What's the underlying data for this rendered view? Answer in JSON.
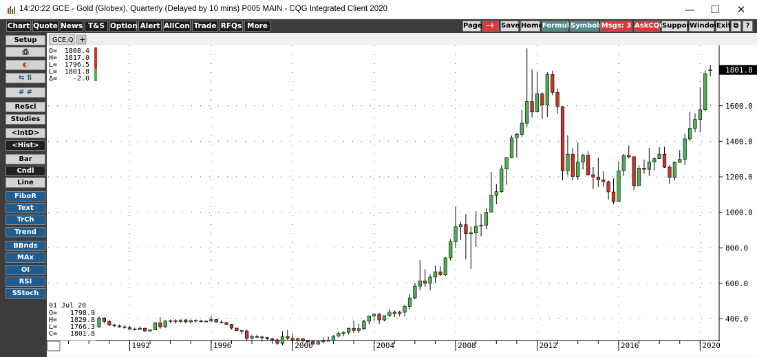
{
  "window": {
    "title": "14:20:22  GCE - Gold (Globex), Quarterly (Delayed by 10 mins)  P005 MAIN - CQG Integrated Client 2020",
    "minimize": "—",
    "maximize": "☐",
    "close": "✕"
  },
  "menu": {
    "left": [
      "Chart",
      "Quote",
      "News",
      "T&S",
      "Options",
      "Alert",
      "AllCon",
      "Trade",
      "RFQs",
      "More"
    ],
    "right": [
      {
        "label": "Page",
        "style": "gray"
      },
      {
        "label": "-+",
        "style": "red"
      },
      {
        "label": "Save",
        "style": "gray"
      },
      {
        "label": "Home",
        "style": "gray"
      },
      {
        "label": "Formula",
        "style": "teal"
      },
      {
        "label": "Symbols",
        "style": "teal"
      },
      {
        "label": "Msgs: 3",
        "style": "red"
      },
      {
        "label": "AskCQG",
        "style": "red"
      },
      {
        "label": "Support",
        "style": "gray"
      },
      {
        "label": "Window",
        "style": "gray"
      },
      {
        "label": "Exit",
        "style": "gray"
      },
      {
        "label": "⧉",
        "style": "gray"
      },
      {
        "label": "?",
        "style": "gray"
      }
    ]
  },
  "sidebar": {
    "items": [
      {
        "label": "Setup",
        "style": "gray"
      },
      {
        "label": "printer-icon",
        "style": "gray",
        "icon": true
      },
      {
        "label": "color-icon",
        "style": "gray",
        "icon": true
      },
      {
        "label": "arrows-icon",
        "style": "gray",
        "icon": true
      },
      {
        "label": "grid-icon",
        "style": "gray",
        "icon": true
      },
      {
        "label": "ReScl",
        "style": "gray"
      },
      {
        "label": "Studies",
        "style": "gray"
      },
      {
        "label": "<IntD>",
        "style": "gray"
      },
      {
        "label": "<Hist>",
        "style": "dark"
      },
      {
        "label": "Bar",
        "style": "gray"
      },
      {
        "label": "Cndl",
        "style": "dark"
      },
      {
        "label": "Line",
        "style": "gray"
      },
      {
        "label": "FiboR",
        "style": "blue"
      },
      {
        "label": "Text",
        "style": "blue"
      },
      {
        "label": "TrCh",
        "style": "blue"
      },
      {
        "label": "Trend",
        "style": "blue"
      },
      {
        "label": "BBnds",
        "style": "blue"
      },
      {
        "label": "MAx",
        "style": "blue"
      },
      {
        "label": "OI",
        "style": "blue"
      },
      {
        "label": "RSI",
        "style": "blue"
      },
      {
        "label": "SStoch",
        "style": "blue"
      }
    ]
  },
  "chart_tab": {
    "label": "GCE,Q",
    "add": "+"
  },
  "ohlc_top": {
    "O": "1808.4",
    "H": "1817.0",
    "L": "1796.5",
    "Lt": "1801.8",
    "Delta": "-2.0"
  },
  "ohlc_bottom": {
    "date": "01 Jul 20",
    "O": "1798.9",
    "H": "1829.8",
    "L": "1766.3",
    "C": "1801.8"
  },
  "last_price_label": "1801.8",
  "colors": {
    "up": "#4caf50",
    "down": "#c0392b",
    "background": "#ffffff"
  },
  "chart_data": {
    "type": "candlestick",
    "title": "GCE - Gold (Globex), Quarterly",
    "y_ticks": [
      "1600.0",
      "1400.0",
      "1200.0",
      "1000.0",
      "800.0",
      "600.0",
      "400.0"
    ],
    "y_tick_values": [
      1600,
      1400,
      1200,
      1000,
      800,
      600,
      400
    ],
    "ylim": [
      282,
      1940
    ],
    "x_ticks": [
      "1992",
      "1996",
      "2000",
      "2004",
      "2008",
      "2012",
      "2016",
      "2020"
    ],
    "x_tick_values": [
      1992,
      1996,
      2000,
      2004,
      2008,
      2012,
      2016,
      2020
    ],
    "xlim": [
      1988.0,
      2020.9
    ],
    "last": 1801.8,
    "candles": [
      {
        "t": 1990.0,
        "o": 395,
        "h": 400,
        "l": 360,
        "c": 375
      },
      {
        "t": 1990.25,
        "o": 375,
        "h": 380,
        "l": 345,
        "c": 355
      },
      {
        "t": 1990.5,
        "o": 355,
        "h": 412,
        "l": 350,
        "c": 405
      },
      {
        "t": 1990.75,
        "o": 405,
        "h": 410,
        "l": 375,
        "c": 385
      },
      {
        "t": 1991.0,
        "o": 385,
        "h": 395,
        "l": 360,
        "c": 365
      },
      {
        "t": 1991.25,
        "o": 365,
        "h": 372,
        "l": 355,
        "c": 360
      },
      {
        "t": 1991.5,
        "o": 360,
        "h": 368,
        "l": 350,
        "c": 355
      },
      {
        "t": 1991.75,
        "o": 355,
        "h": 365,
        "l": 345,
        "c": 352
      },
      {
        "t": 1992.0,
        "o": 352,
        "h": 360,
        "l": 338,
        "c": 342
      },
      {
        "t": 1992.25,
        "o": 342,
        "h": 350,
        "l": 335,
        "c": 340
      },
      {
        "t": 1992.5,
        "o": 340,
        "h": 358,
        "l": 338,
        "c": 347
      },
      {
        "t": 1992.75,
        "o": 347,
        "h": 352,
        "l": 325,
        "c": 332
      },
      {
        "t": 1993.0,
        "o": 332,
        "h": 340,
        "l": 326,
        "c": 338
      },
      {
        "t": 1993.25,
        "o": 338,
        "h": 382,
        "l": 336,
        "c": 378
      },
      {
        "t": 1993.5,
        "o": 378,
        "h": 410,
        "l": 345,
        "c": 355
      },
      {
        "t": 1993.75,
        "o": 355,
        "h": 392,
        "l": 350,
        "c": 388
      },
      {
        "t": 1994.0,
        "o": 388,
        "h": 396,
        "l": 376,
        "c": 390
      },
      {
        "t": 1994.25,
        "o": 390,
        "h": 398,
        "l": 372,
        "c": 385
      },
      {
        "t": 1994.5,
        "o": 385,
        "h": 395,
        "l": 378,
        "c": 394
      },
      {
        "t": 1994.75,
        "o": 394,
        "h": 398,
        "l": 375,
        "c": 383
      },
      {
        "t": 1995.0,
        "o": 383,
        "h": 396,
        "l": 373,
        "c": 391
      },
      {
        "t": 1995.25,
        "o": 391,
        "h": 397,
        "l": 380,
        "c": 388
      },
      {
        "t": 1995.5,
        "o": 388,
        "h": 394,
        "l": 380,
        "c": 384
      },
      {
        "t": 1995.75,
        "o": 384,
        "h": 392,
        "l": 380,
        "c": 387
      },
      {
        "t": 1996.0,
        "o": 387,
        "h": 418,
        "l": 384,
        "c": 396
      },
      {
        "t": 1996.25,
        "o": 396,
        "h": 400,
        "l": 380,
        "c": 382
      },
      {
        "t": 1996.5,
        "o": 382,
        "h": 392,
        "l": 378,
        "c": 379
      },
      {
        "t": 1996.75,
        "o": 379,
        "h": 384,
        "l": 365,
        "c": 369
      },
      {
        "t": 1997.0,
        "o": 369,
        "h": 371,
        "l": 340,
        "c": 348
      },
      {
        "t": 1997.25,
        "o": 348,
        "h": 350,
        "l": 333,
        "c": 334
      },
      {
        "t": 1997.5,
        "o": 334,
        "h": 336,
        "l": 315,
        "c": 332
      },
      {
        "t": 1997.75,
        "o": 332,
        "h": 340,
        "l": 280,
        "c": 290
      },
      {
        "t": 1998.0,
        "o": 290,
        "h": 310,
        "l": 284,
        "c": 300
      },
      {
        "t": 1998.25,
        "o": 300,
        "h": 312,
        "l": 290,
        "c": 298
      },
      {
        "t": 1998.5,
        "o": 298,
        "h": 305,
        "l": 272,
        "c": 295
      },
      {
        "t": 1998.75,
        "o": 295,
        "h": 298,
        "l": 280,
        "c": 288
      },
      {
        "t": 1999.0,
        "o": 288,
        "h": 292,
        "l": 276,
        "c": 282
      },
      {
        "t": 1999.25,
        "o": 282,
        "h": 288,
        "l": 255,
        "c": 262
      },
      {
        "t": 1999.5,
        "o": 262,
        "h": 330,
        "l": 252,
        "c": 300
      },
      {
        "t": 1999.75,
        "o": 300,
        "h": 338,
        "l": 282,
        "c": 290
      },
      {
        "t": 2000.0,
        "o": 290,
        "h": 316,
        "l": 276,
        "c": 280
      },
      {
        "t": 2000.25,
        "o": 280,
        "h": 293,
        "l": 272,
        "c": 289
      },
      {
        "t": 2000.5,
        "o": 289,
        "h": 290,
        "l": 268,
        "c": 275
      },
      {
        "t": 2000.75,
        "o": 275,
        "h": 278,
        "l": 263,
        "c": 272
      },
      {
        "t": 2001.0,
        "o": 272,
        "h": 274,
        "l": 256,
        "c": 258
      },
      {
        "t": 2001.25,
        "o": 258,
        "h": 276,
        "l": 255,
        "c": 271
      },
      {
        "t": 2001.5,
        "o": 271,
        "h": 295,
        "l": 264,
        "c": 276
      },
      {
        "t": 2001.75,
        "o": 276,
        "h": 300,
        "l": 274,
        "c": 278
      },
      {
        "t": 2002.0,
        "o": 278,
        "h": 308,
        "l": 276,
        "c": 303
      },
      {
        "t": 2002.25,
        "o": 303,
        "h": 330,
        "l": 296,
        "c": 318
      },
      {
        "t": 2002.5,
        "o": 318,
        "h": 330,
        "l": 302,
        "c": 324
      },
      {
        "t": 2002.75,
        "o": 324,
        "h": 350,
        "l": 312,
        "c": 347
      },
      {
        "t": 2003.0,
        "o": 347,
        "h": 390,
        "l": 320,
        "c": 335
      },
      {
        "t": 2003.25,
        "o": 335,
        "h": 372,
        "l": 320,
        "c": 345
      },
      {
        "t": 2003.5,
        "o": 345,
        "h": 395,
        "l": 338,
        "c": 387
      },
      {
        "t": 2003.75,
        "o": 387,
        "h": 418,
        "l": 370,
        "c": 417
      },
      {
        "t": 2004.0,
        "o": 417,
        "h": 432,
        "l": 388,
        "c": 426
      },
      {
        "t": 2004.25,
        "o": 426,
        "h": 434,
        "l": 371,
        "c": 394
      },
      {
        "t": 2004.5,
        "o": 394,
        "h": 418,
        "l": 386,
        "c": 418
      },
      {
        "t": 2004.75,
        "o": 418,
        "h": 456,
        "l": 410,
        "c": 438
      },
      {
        "t": 2005.0,
        "o": 438,
        "h": 447,
        "l": 410,
        "c": 430
      },
      {
        "t": 2005.25,
        "o": 430,
        "h": 445,
        "l": 415,
        "c": 437
      },
      {
        "t": 2005.5,
        "o": 437,
        "h": 480,
        "l": 415,
        "c": 470
      },
      {
        "t": 2005.75,
        "o": 470,
        "h": 540,
        "l": 455,
        "c": 518
      },
      {
        "t": 2006.0,
        "o": 518,
        "h": 600,
        "l": 510,
        "c": 584
      },
      {
        "t": 2006.25,
        "o": 584,
        "h": 732,
        "l": 560,
        "c": 614
      },
      {
        "t": 2006.5,
        "o": 614,
        "h": 680,
        "l": 580,
        "c": 600
      },
      {
        "t": 2006.75,
        "o": 600,
        "h": 650,
        "l": 560,
        "c": 635
      },
      {
        "t": 2007.0,
        "o": 635,
        "h": 700,
        "l": 600,
        "c": 665
      },
      {
        "t": 2007.25,
        "o": 665,
        "h": 697,
        "l": 642,
        "c": 648
      },
      {
        "t": 2007.5,
        "o": 648,
        "h": 748,
        "l": 642,
        "c": 743
      },
      {
        "t": 2007.75,
        "o": 743,
        "h": 850,
        "l": 728,
        "c": 834
      },
      {
        "t": 2008.0,
        "o": 834,
        "h": 1033,
        "l": 800,
        "c": 919
      },
      {
        "t": 2008.25,
        "o": 919,
        "h": 948,
        "l": 845,
        "c": 930
      },
      {
        "t": 2008.5,
        "o": 930,
        "h": 990,
        "l": 735,
        "c": 880
      },
      {
        "t": 2008.75,
        "o": 880,
        "h": 920,
        "l": 681,
        "c": 884
      },
      {
        "t": 2009.0,
        "o": 884,
        "h": 1007,
        "l": 805,
        "c": 922
      },
      {
        "t": 2009.25,
        "o": 922,
        "h": 992,
        "l": 865,
        "c": 927
      },
      {
        "t": 2009.5,
        "o": 927,
        "h": 1025,
        "l": 904,
        "c": 1001
      },
      {
        "t": 2009.75,
        "o": 1001,
        "h": 1227,
        "l": 998,
        "c": 1095
      },
      {
        "t": 2010.0,
        "o": 1095,
        "h": 1160,
        "l": 1045,
        "c": 1116
      },
      {
        "t": 2010.25,
        "o": 1116,
        "h": 1266,
        "l": 1110,
        "c": 1244
      },
      {
        "t": 2010.5,
        "o": 1244,
        "h": 1312,
        "l": 1155,
        "c": 1307
      },
      {
        "t": 2010.75,
        "o": 1307,
        "h": 1432,
        "l": 1305,
        "c": 1420
      },
      {
        "t": 2011.0,
        "o": 1420,
        "h": 1448,
        "l": 1308,
        "c": 1439
      },
      {
        "t": 2011.25,
        "o": 1439,
        "h": 1577,
        "l": 1424,
        "c": 1502
      },
      {
        "t": 2011.5,
        "o": 1502,
        "h": 1923,
        "l": 1478,
        "c": 1624
      },
      {
        "t": 2011.75,
        "o": 1624,
        "h": 1804,
        "l": 1534,
        "c": 1565
      },
      {
        "t": 2012.0,
        "o": 1565,
        "h": 1792,
        "l": 1563,
        "c": 1668
      },
      {
        "t": 2012.25,
        "o": 1668,
        "h": 1675,
        "l": 1526,
        "c": 1604
      },
      {
        "t": 2012.5,
        "o": 1604,
        "h": 1790,
        "l": 1537,
        "c": 1776
      },
      {
        "t": 2012.75,
        "o": 1776,
        "h": 1798,
        "l": 1660,
        "c": 1675
      },
      {
        "t": 2013.0,
        "o": 1675,
        "h": 1697,
        "l": 1555,
        "c": 1595
      },
      {
        "t": 2013.25,
        "o": 1595,
        "h": 1600,
        "l": 1180,
        "c": 1234
      },
      {
        "t": 2013.5,
        "o": 1234,
        "h": 1434,
        "l": 1208,
        "c": 1327
      },
      {
        "t": 2013.75,
        "o": 1327,
        "h": 1362,
        "l": 1180,
        "c": 1202
      },
      {
        "t": 2014.0,
        "o": 1202,
        "h": 1392,
        "l": 1182,
        "c": 1283
      },
      {
        "t": 2014.25,
        "o": 1283,
        "h": 1330,
        "l": 1241,
        "c": 1322
      },
      {
        "t": 2014.5,
        "o": 1322,
        "h": 1345,
        "l": 1207,
        "c": 1211
      },
      {
        "t": 2014.75,
        "o": 1211,
        "h": 1255,
        "l": 1131,
        "c": 1199
      },
      {
        "t": 2015.0,
        "o": 1199,
        "h": 1307,
        "l": 1143,
        "c": 1183
      },
      {
        "t": 2015.25,
        "o": 1183,
        "h": 1232,
        "l": 1142,
        "c": 1172
      },
      {
        "t": 2015.5,
        "o": 1172,
        "h": 1180,
        "l": 1072,
        "c": 1115
      },
      {
        "t": 2015.75,
        "o": 1115,
        "h": 1191,
        "l": 1045,
        "c": 1060
      },
      {
        "t": 2016.0,
        "o": 1060,
        "h": 1287,
        "l": 1061,
        "c": 1234
      },
      {
        "t": 2016.25,
        "o": 1234,
        "h": 1330,
        "l": 1205,
        "c": 1320
      },
      {
        "t": 2016.5,
        "o": 1320,
        "h": 1377,
        "l": 1303,
        "c": 1313
      },
      {
        "t": 2016.75,
        "o": 1313,
        "h": 1314,
        "l": 1124,
        "c": 1150
      },
      {
        "t": 2017.0,
        "o": 1150,
        "h": 1264,
        "l": 1149,
        "c": 1249
      },
      {
        "t": 2017.25,
        "o": 1249,
        "h": 1296,
        "l": 1218,
        "c": 1242
      },
      {
        "t": 2017.5,
        "o": 1242,
        "h": 1362,
        "l": 1205,
        "c": 1283
      },
      {
        "t": 2017.75,
        "o": 1283,
        "h": 1310,
        "l": 1236,
        "c": 1302
      },
      {
        "t": 2018.0,
        "o": 1302,
        "h": 1366,
        "l": 1302,
        "c": 1327
      },
      {
        "t": 2018.25,
        "o": 1327,
        "h": 1369,
        "l": 1250,
        "c": 1254
      },
      {
        "t": 2018.5,
        "o": 1254,
        "h": 1265,
        "l": 1160,
        "c": 1196
      },
      {
        "t": 2018.75,
        "o": 1196,
        "h": 1287,
        "l": 1180,
        "c": 1281
      },
      {
        "t": 2019.0,
        "o": 1281,
        "h": 1350,
        "l": 1280,
        "c": 1298
      },
      {
        "t": 2019.25,
        "o": 1298,
        "h": 1442,
        "l": 1266,
        "c": 1413
      },
      {
        "t": 2019.5,
        "o": 1413,
        "h": 1566,
        "l": 1400,
        "c": 1473
      },
      {
        "t": 2019.75,
        "o": 1473,
        "h": 1557,
        "l": 1451,
        "c": 1523
      },
      {
        "t": 2020.0,
        "o": 1523,
        "h": 1704,
        "l": 1451,
        "c": 1577
      },
      {
        "t": 2020.25,
        "o": 1577,
        "h": 1800,
        "l": 1568,
        "c": 1781
      },
      {
        "t": 2020.5,
        "o": 1798.9,
        "h": 1829.8,
        "l": 1766.3,
        "c": 1801.8
      }
    ]
  }
}
